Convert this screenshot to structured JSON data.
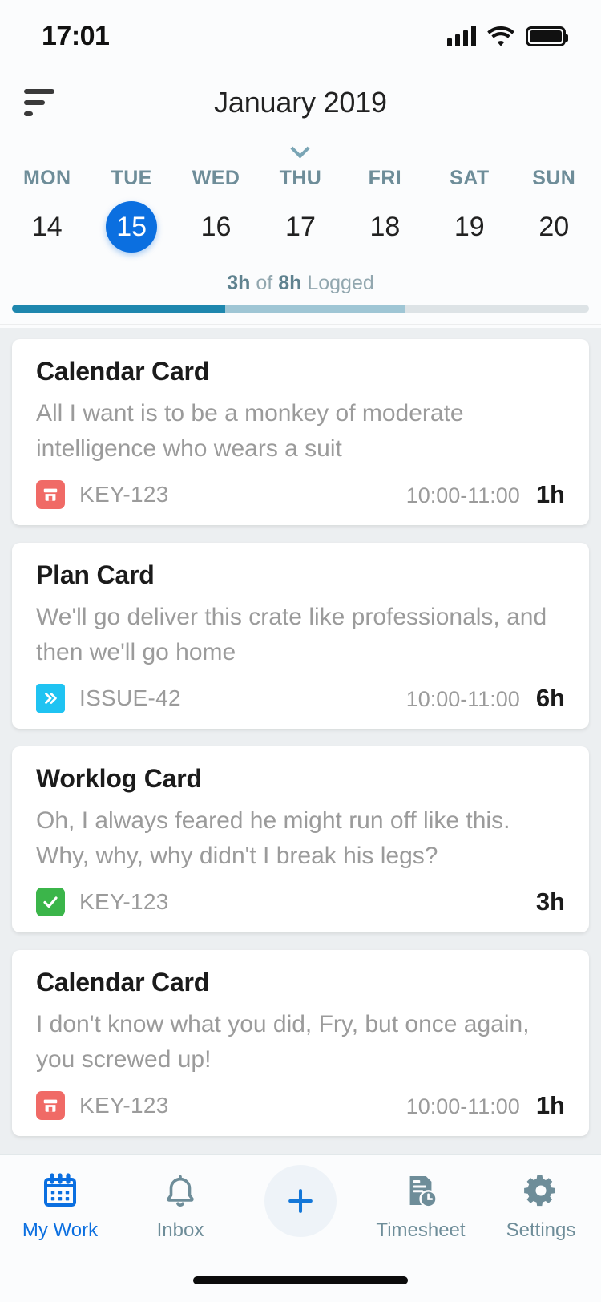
{
  "status_bar": {
    "time": "17:01",
    "signal_icon": "cellular-signal-icon",
    "wifi_icon": "wifi-icon",
    "battery_icon": "battery-full-icon"
  },
  "header": {
    "filter_icon": "filter-sort-icon",
    "month_title": "January 2019",
    "expand_icon": "chevron-down-icon",
    "weekdays": [
      "MON",
      "TUE",
      "WED",
      "THU",
      "FRI",
      "SAT",
      "SUN"
    ],
    "dates": [
      "14",
      "15",
      "16",
      "17",
      "18",
      "19",
      "20"
    ],
    "selected_date_index": 1,
    "logged": {
      "amount": "3h",
      "connector": "of",
      "target": "8h",
      "suffix": "Logged"
    },
    "progress": {
      "logged_percent": 37,
      "planned_percent": 31,
      "logged_color": "#1e87ae",
      "planned_color": "#9fc6d5",
      "track_color": "#dde3e6"
    }
  },
  "cards": [
    {
      "title": "Calendar Card",
      "description": "All I want is to be a monkey of moderate intelligence who wears a suit",
      "icon": "calendar-event-box-icon",
      "icon_color": "#f06a66",
      "key": "KEY-123",
      "time_range": "10:00-11:00",
      "duration": "1h"
    },
    {
      "title": "Plan Card",
      "description": "We'll go deliver this crate like professionals, and then we'll go home",
      "icon": "double-chevron-right-icon",
      "icon_color": "#1fc3f2",
      "key": "ISSUE-42",
      "time_range": "10:00-11:00",
      "duration": "6h"
    },
    {
      "title": "Worklog Card",
      "description": "Oh, I always feared he might run off like this. Why, why, why didn't I break his legs?",
      "icon": "check-mark-icon",
      "icon_color": "#3bb54a",
      "key": "KEY-123",
      "time_range": "",
      "duration": "3h"
    },
    {
      "title": "Calendar Card",
      "description": "I don't know what you did, Fry, but once again, you screwed up!",
      "icon": "calendar-event-box-icon",
      "icon_color": "#f06a66",
      "key": "KEY-123",
      "time_range": "10:00-11:00",
      "duration": "1h"
    }
  ],
  "tabbar": {
    "items": [
      {
        "label": "My Work",
        "icon": "calendar-icon",
        "active": true
      },
      {
        "label": "Inbox",
        "icon": "bell-icon",
        "active": false
      },
      {
        "label": "",
        "icon": "plus-icon",
        "active": false
      },
      {
        "label": "Timesheet",
        "icon": "timesheet-clock-icon",
        "active": false
      },
      {
        "label": "Settings",
        "icon": "gear-icon",
        "active": false
      }
    ],
    "active_color": "#0b6fe0",
    "inactive_color": "#6e8d99"
  },
  "home_indicator": "home-indicator"
}
